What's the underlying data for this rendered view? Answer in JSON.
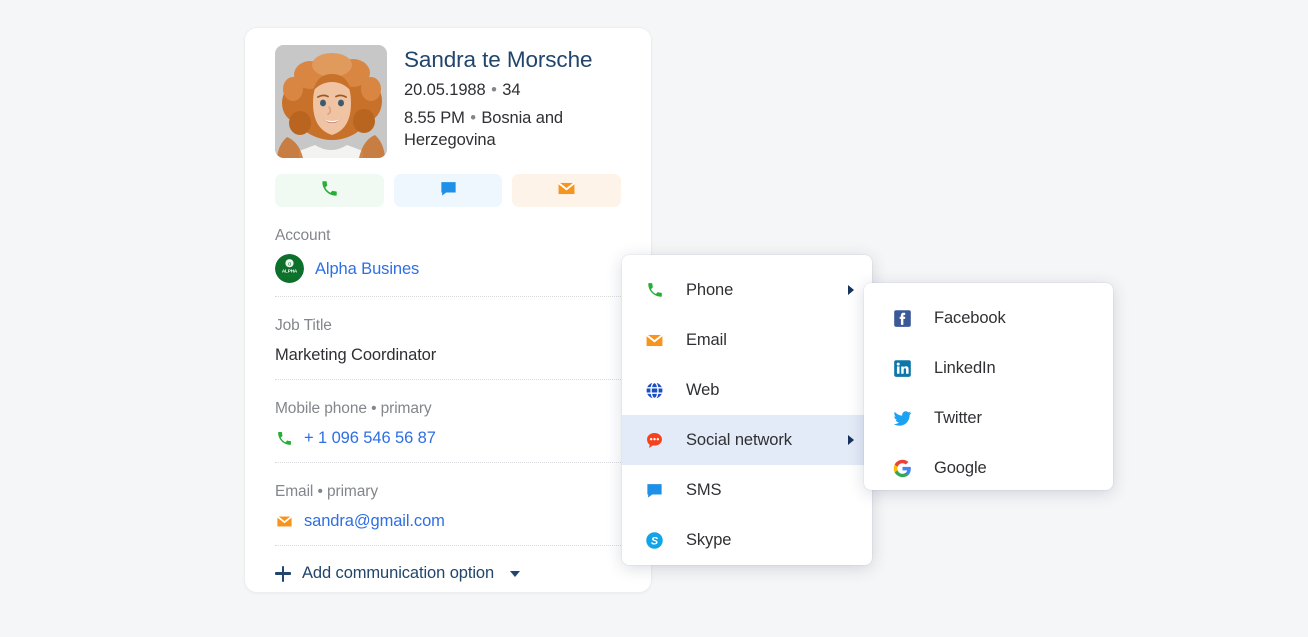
{
  "background_color": "#f5f6f7",
  "card": {
    "person": {
      "name": "Sandra te Morsche",
      "birthdate": "20.05.1988",
      "separator": "•",
      "age": "34",
      "local_time": "8.55 PM",
      "location": "Bosnia and Herzegovina"
    },
    "quick_actions": [
      {
        "name": "call",
        "icon": "phone-icon",
        "color": "#27ae36",
        "background": "#f1faf2"
      },
      {
        "name": "sms",
        "icon": "chat-bubble-icon",
        "color": "#1e90e8",
        "background": "#eef6fe"
      },
      {
        "name": "email",
        "icon": "envelope-icon",
        "color": "#f7941d",
        "background": "#fdf3e9"
      }
    ],
    "fields": [
      {
        "label": "Account",
        "value": "Alpha Busines",
        "value_style": "link",
        "icon": "company-logo-icon"
      },
      {
        "label": "Job Title",
        "value": "Marketing Coordinator",
        "value_style": "plain",
        "icon": ""
      },
      {
        "label": "Mobile phone • primary",
        "value": "+ 1 096 546 56 87",
        "value_style": "link",
        "icon": "phone-icon"
      },
      {
        "label": "Email • primary",
        "value": "sandra@gmail.com",
        "value_style": "link",
        "icon": "envelope-icon"
      }
    ],
    "add_option": {
      "label": "Add communication option",
      "plus_icon": "plus-icon",
      "caret_icon": "chevron-down-icon"
    }
  },
  "menu_primary": {
    "items": [
      {
        "label": "Phone",
        "icon": "phone-icon",
        "has_submenu": true,
        "highlighted": false
      },
      {
        "label": "Email",
        "icon": "envelope-icon",
        "has_submenu": false,
        "highlighted": false
      },
      {
        "label": "Web",
        "icon": "globe-icon",
        "has_submenu": false,
        "highlighted": false
      },
      {
        "label": "Social network",
        "icon": "speech-bubble-icon",
        "has_submenu": true,
        "highlighted": true
      },
      {
        "label": "SMS",
        "icon": "chat-bubble-icon",
        "has_submenu": false,
        "highlighted": false
      },
      {
        "label": "Skype",
        "icon": "skype-icon",
        "has_submenu": false,
        "highlighted": false
      }
    ],
    "highlight_color": "#e3eaf8"
  },
  "menu_social": {
    "items": [
      {
        "label": "Facebook",
        "icon": "facebook-icon"
      },
      {
        "label": "LinkedIn",
        "icon": "linkedin-icon"
      },
      {
        "label": "Twitter",
        "icon": "twitter-icon"
      },
      {
        "label": "Google",
        "icon": "google-icon"
      }
    ]
  }
}
